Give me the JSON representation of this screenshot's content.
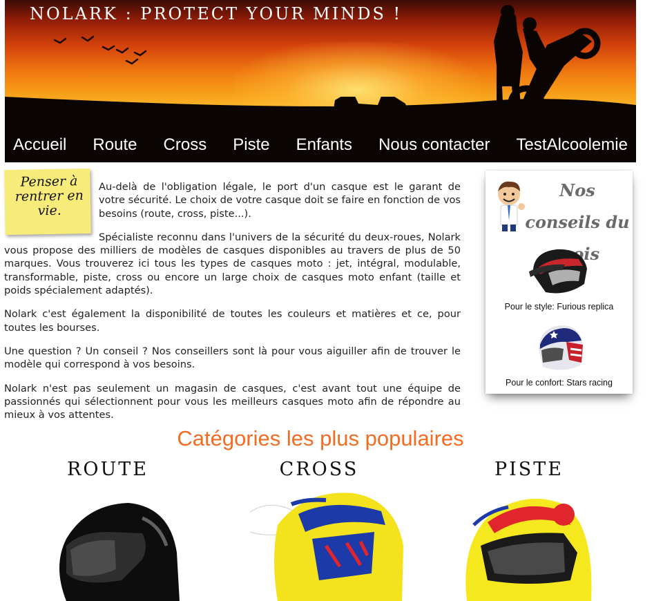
{
  "banner": {
    "title": "NOLARK : PROTECT YOUR MINDS !"
  },
  "nav": {
    "items": [
      "Accueil",
      "Route",
      "Cross",
      "Piste",
      "Enfants",
      "Nous contacter",
      "TestAlcoolemie"
    ]
  },
  "note": {
    "text": "Penser à rentrer en vie."
  },
  "content": {
    "paragraphs": [
      "Au-delà de l'obligation légale, le port d'un casque est le garant de votre sécurité. Le choix de votre casque doit se faire en fonction de vos besoins (route, cross, piste...).",
      "Spécialiste reconnu dans l'univers de la sécurité du deux-roues, Nolark vous propose des milliers de modèles de casques disponibles au travers de plus de 50 marques. Vous trouverez ici tous les types de casques moto : jet, intégral, modulable, transformable, piste, cross ou encore un large choix de casques moto enfant (taille et poids spécialement adaptés).",
      "Nolark c'est également la disponibilité de toutes les couleurs et matières et ce, pour toutes les bourses.",
      "Une question ? Un conseil ? Nos conseillers sont là pour vous aiguiller afin de trouver le modèle qui correspond à vos besoins.",
      "Nolark n'est pas seulement un magasin de casques, c'est avant tout une équipe de passionnés qui sélectionnent pour vous les meilleurs casques moto afin de répondre au mieux à vos attentes."
    ]
  },
  "conseils": {
    "title": "Nos conseils du mois",
    "products": [
      {
        "caption": "Pour le style: Furious replica",
        "icon": "cross-helmet-icon"
      },
      {
        "caption": "Pour le confort: Stars racing",
        "icon": "stars-helmet-icon"
      }
    ]
  },
  "categories": {
    "heading": "Catégories les plus populaires",
    "items": [
      {
        "label": "ROUTE",
        "icon": "route-helmet-icon"
      },
      {
        "label": "CROSS",
        "icon": "cross-helmet-icon"
      },
      {
        "label": "PISTE",
        "icon": "piste-helmet-icon"
      }
    ]
  },
  "colors": {
    "accent": "#f36c21",
    "nav_bg": "#000000",
    "note_yellow": "#f7ec7a"
  }
}
